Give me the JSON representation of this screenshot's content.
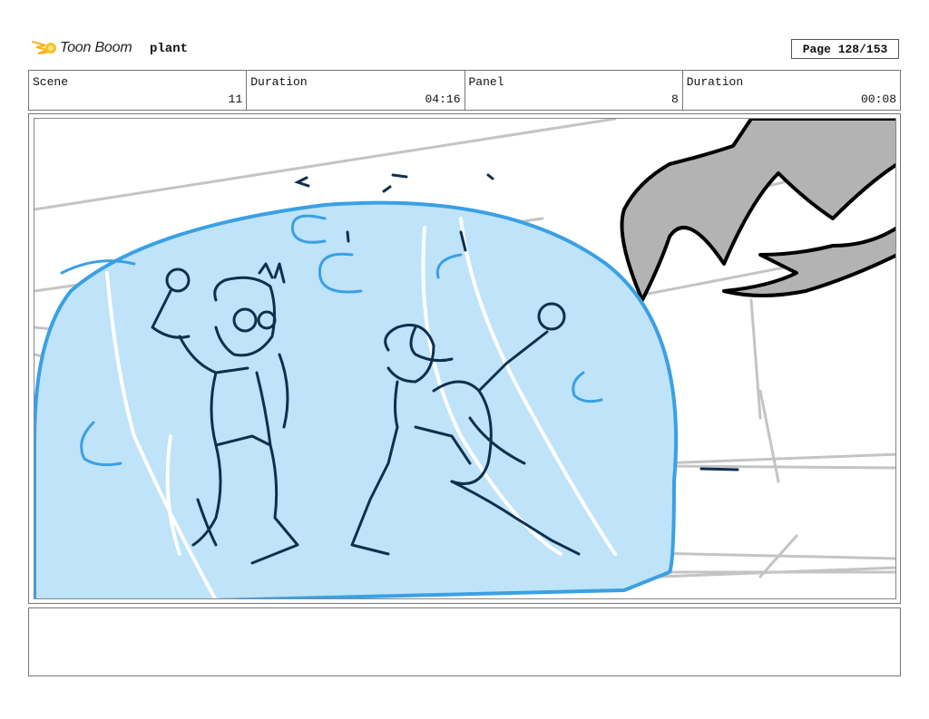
{
  "header": {
    "logo_text": "Toon Boom",
    "project_name": "plant",
    "page_label": "Page 128/153"
  },
  "info": {
    "scene_label": "Scene",
    "scene_value": "11",
    "duration_label": "Duration",
    "duration_value": "04:16",
    "panel_label": "Panel",
    "panel_value": "8",
    "panel_duration_label": "Duration",
    "panel_duration_value": "00:08"
  },
  "panel": {
    "colors": {
      "bubble_fill": "#bfe3f8",
      "bubble_outline": "#3aa0e4",
      "ink": "#0f2f4f",
      "background_lines": "#c4c4c4",
      "monster": "#b3b3b3"
    }
  },
  "notes": {
    "text": ""
  }
}
